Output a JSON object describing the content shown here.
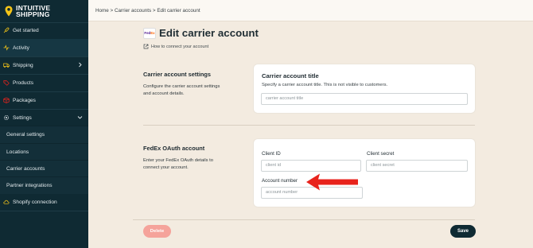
{
  "sidebar": {
    "logo_text": "INTUITIVE\nSHIPPING",
    "items": [
      {
        "label": "Get started",
        "icon": "rocket-icon"
      },
      {
        "label": "Activity",
        "icon": "activity-icon"
      },
      {
        "label": "Shipping",
        "icon": "truck-icon"
      },
      {
        "label": "Products",
        "icon": "tag-icon"
      },
      {
        "label": "Packages",
        "icon": "box-icon"
      },
      {
        "label": "Settings",
        "icon": "gear-icon"
      }
    ],
    "sub_items": [
      {
        "label": "General settings"
      },
      {
        "label": "Locations"
      },
      {
        "label": "Carrier accounts"
      },
      {
        "label": "Partner integrations"
      }
    ],
    "shopify": {
      "label": "Shopify connection",
      "icon": "cloud-icon"
    }
  },
  "header": {
    "breadcrumb": "Home > Carrier accounts > Edit carrier account"
  },
  "main": {
    "title": "Edit carrier account",
    "carrier_logo": {
      "fe": "Fed",
      "ex": "Ex"
    },
    "help_link": "How to connect your account",
    "section1": {
      "title": "Carrier account settings",
      "description_line1": "Configure the carrier account settings",
      "description_line2": "and account details.",
      "card_title": "Carrier account title",
      "card_sub": "Specify a carrier account title. This is not visible to customers.",
      "input_placeholder": "carrier account title"
    },
    "section2": {
      "title": "FedEx OAuth account",
      "description_line1": "Enter your FedEx OAuth details to",
      "description_line2": "connect your account.",
      "client_id_label": "Client ID",
      "client_id_placeholder": "client id",
      "client_secret_label": "Client secret",
      "client_secret_placeholder": "client secret",
      "account_number_label": "Account number",
      "account_number_placeholder": "account number"
    },
    "delete_label": "Delete",
    "save_label": "Save"
  },
  "colors": {
    "sidebar_bg": "#0f2a33",
    "page_bg": "#f3ebe0",
    "delete_bg": "#f5a39b",
    "save_bg": "#0f2a33",
    "arrow": "#e8231c",
    "logo_accent": "#f5c518"
  }
}
